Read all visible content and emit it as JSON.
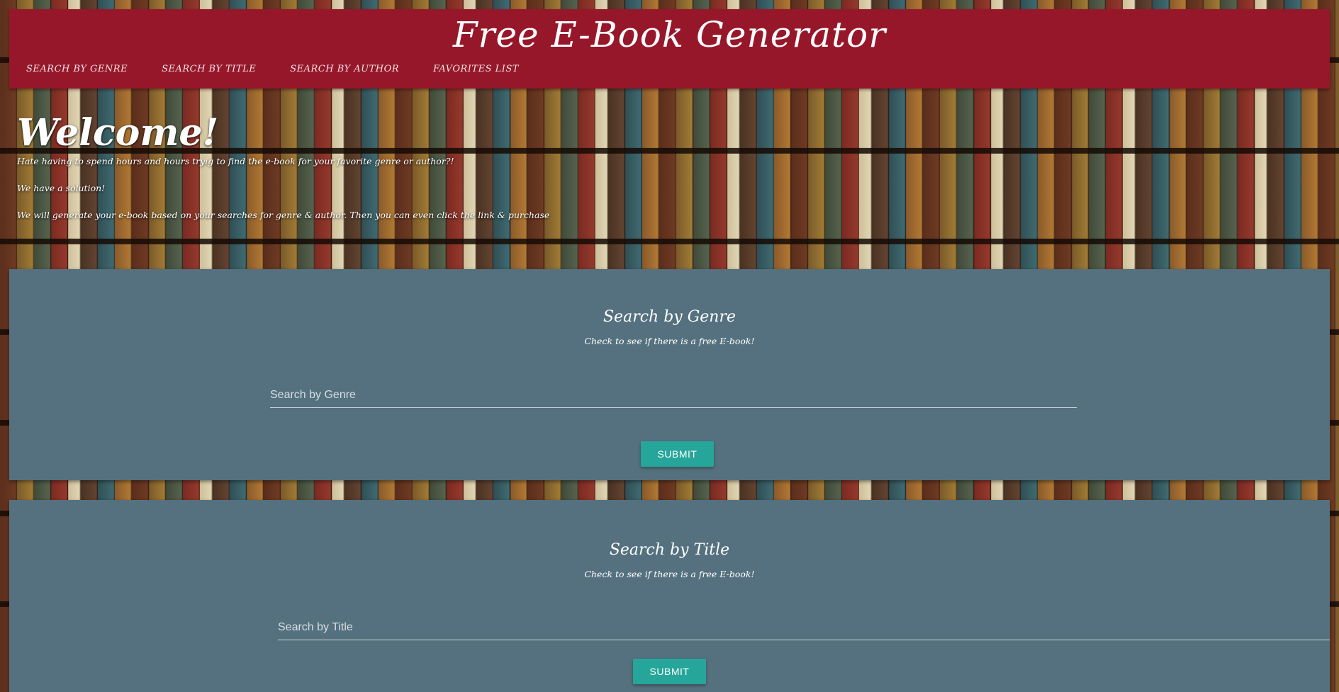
{
  "header": {
    "title": "Free E-Book Generator",
    "nav": [
      {
        "label": "Search by Genre"
      },
      {
        "label": "Search by Title"
      },
      {
        "label": "Search by Author"
      },
      {
        "label": "Favorites List"
      }
    ]
  },
  "hero": {
    "heading": "Welcome!",
    "line1": "Hate having to spend hours and hours tryig to find the e-book for your favorite genre or author?!",
    "line2": "We have a solution!",
    "line3": "We will generate your e-book based on your searches for genre & author. Then you can even click the link & purchase"
  },
  "genre_search": {
    "heading": "Search by Genre",
    "subtitle": "Check to see if there is a free E-book!",
    "placeholder": "Search by Genre",
    "submit_label": "SUBMIT"
  },
  "title_search": {
    "heading": "Search by Title",
    "subtitle": "Check to see if there is a free E-book!",
    "placeholder": "Search by Title",
    "submit_label": "SUBMIT"
  },
  "colors": {
    "header_bg": "#97172a",
    "panel_bg": "#55717f",
    "button_bg": "#26a69a"
  }
}
